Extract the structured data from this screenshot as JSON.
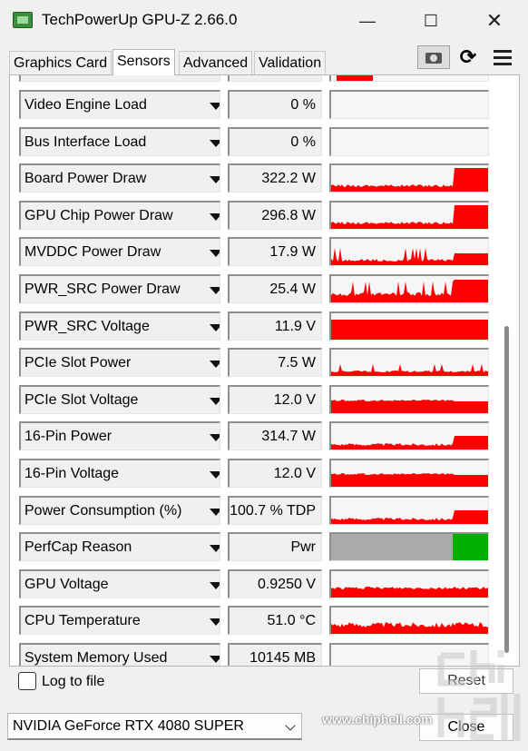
{
  "window": {
    "title": "TechPowerUp GPU-Z 2.66.0",
    "minimize_label": "—",
    "maximize_label": "☐",
    "close_label": "✕"
  },
  "tabs": [
    {
      "label": "Graphics Card",
      "active": false
    },
    {
      "label": "Sensors",
      "active": true
    },
    {
      "label": "Advanced",
      "active": false
    },
    {
      "label": "Validation",
      "active": false
    }
  ],
  "toolbar": {
    "screenshot_icon": "camera-icon",
    "refresh_icon": "refresh-icon",
    "refresh_glyph": "⟳",
    "menu_icon": "hamburger-menu-icon"
  },
  "colors": {
    "graph_fill": "#ff0000",
    "perfcap_idle": "#aaaaaa",
    "perfcap_pwr": "#00b000",
    "accent": "#0078d4"
  },
  "sensors": [
    {
      "name": "Video Engine Load",
      "value": "0 %",
      "graph": "empty"
    },
    {
      "name": "Bus Interface Load",
      "value": "0 %",
      "graph": "empty"
    },
    {
      "name": "Board Power Draw",
      "value": "322.2 W",
      "graph": "spike"
    },
    {
      "name": "GPU Chip Power Draw",
      "value": "296.8 W",
      "graph": "spike"
    },
    {
      "name": "MVDDC Power Draw",
      "value": "17.9 W",
      "graph": "spiky"
    },
    {
      "name": "PWR_SRC Power Draw",
      "value": "25.4 W",
      "graph": "spiky-high"
    },
    {
      "name": "PWR_SRC Voltage",
      "value": "11.9 V",
      "graph": "flat-high"
    },
    {
      "name": "PCIe Slot Power",
      "value": "7.5 W",
      "graph": "low-spiky"
    },
    {
      "name": "PCIe Slot Voltage",
      "value": "12.0 V",
      "graph": "flat-mid"
    },
    {
      "name": "16-Pin Power",
      "value": "314.7 W",
      "graph": "spike-mid"
    },
    {
      "name": "16-Pin Voltage",
      "value": "12.0 V",
      "graph": "flat-mid"
    },
    {
      "name": "Power Consumption (%)",
      "value": "100.7 % TDP",
      "graph": "spike-mid"
    },
    {
      "name": "PerfCap Reason",
      "value": "Pwr",
      "graph": "perfcap"
    },
    {
      "name": "GPU Voltage",
      "value": "0.9250 V",
      "graph": "low-flat"
    },
    {
      "name": "CPU Temperature",
      "value": "51.0 °C",
      "graph": "noisy-low"
    },
    {
      "name": "System Memory Used",
      "value": "10145 MB",
      "graph": "empty"
    }
  ],
  "footer": {
    "log_label": "Log to file",
    "log_checked": false,
    "reset_label": "Reset",
    "gpu_selected": "NVIDIA GeForce RTX 4080 SUPER",
    "close_label": "Close"
  },
  "watermark": {
    "text": "www.chiphell.com"
  }
}
